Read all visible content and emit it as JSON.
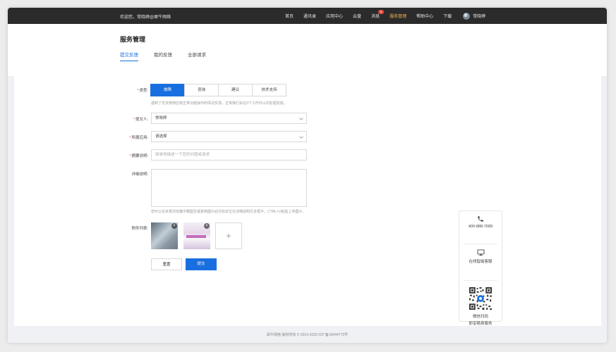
{
  "topbar": {
    "welcome": "欢迎您，常晓婷@犀牛网络",
    "nav": [
      {
        "label": "首页"
      },
      {
        "label": "通讯录"
      },
      {
        "label": "应用中心"
      },
      {
        "label": "云盘"
      },
      {
        "label": "消息",
        "badge": "9"
      },
      {
        "label": "服务管理",
        "active": true
      },
      {
        "label": "帮助中心"
      },
      {
        "label": "下载"
      }
    ],
    "user_name": "常晓婷"
  },
  "page": {
    "title": "服务管理",
    "tabs": [
      {
        "label": "提交反馈",
        "active": true
      },
      {
        "label": "我的反馈"
      },
      {
        "label": "全部请求"
      }
    ]
  },
  "form": {
    "type_label": "类型:",
    "types": [
      "故障",
      "咨询",
      "建议",
      "技术支持"
    ],
    "type_selected": "故障",
    "type_hint": "遇到了无法使用应用正常功能操作的情况反馈。正常我们会在3个工作日以内处理完成。",
    "submitter_label": "提交人:",
    "submitter_value": "常晓婷",
    "app_label": "所属应用:",
    "app_placeholder": "请选择",
    "summary_label": "摘要说明:",
    "summary_placeholder": "简单地描述一下您的问题或请求",
    "detail_label": "详细说明:",
    "detail_hint": "您可以在目录浏览器中截图至或复制图片后光标定位在详细说明文本框中，CTRL+V粘贴上传图片。",
    "attachments_label": "附件列表:",
    "reset_label": "重置",
    "submit_label": "提交"
  },
  "side_panel": {
    "phone": "400-888-7689",
    "online_service": "在线智能客服",
    "wechat_line1": "微信扫码",
    "wechat_line2": "即享随身服务"
  },
  "footer": "犀牛网络 版权所有 © 2014-2020 ICP 备14044779号",
  "colors": {
    "primary": "#1a6fe0",
    "topbar": "#2b2b2b",
    "active_nav": "#f4b24a",
    "required": "#e84c3d"
  }
}
